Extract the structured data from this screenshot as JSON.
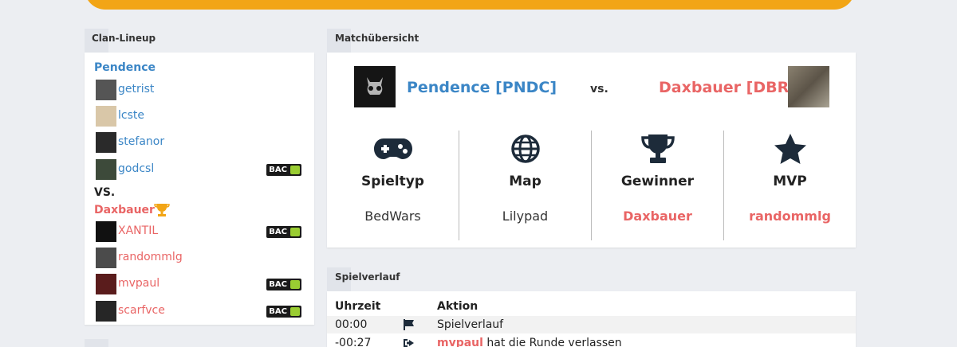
{
  "lineup": {
    "header": "Clan-Lineup",
    "team_a": {
      "name": "Pendence",
      "players": [
        {
          "name": "getrist",
          "bac": false
        },
        {
          "name": "lcste",
          "bac": false
        },
        {
          "name": "stefanor",
          "bac": false
        },
        {
          "name": "godcsl",
          "bac": true
        }
      ]
    },
    "vs": "VS.",
    "team_b": {
      "name": "Daxbauer",
      "players": [
        {
          "name": "XANTIL",
          "bac": true
        },
        {
          "name": "randommlg",
          "bac": false
        },
        {
          "name": "mvpaul",
          "bac": true
        },
        {
          "name": "scarfvce",
          "bac": true
        }
      ]
    },
    "bac_label": "BAC"
  },
  "overview": {
    "header": "Matchübersicht",
    "team_a": "Pendence [PNDC]",
    "vs": "vs.",
    "team_b": "Daxbauer [DBR]",
    "stats": [
      {
        "title": "Spieltyp",
        "value": "BedWars",
        "icon": "gamepad-icon"
      },
      {
        "title": "Map",
        "value": "Lilypad",
        "icon": "globe-icon"
      },
      {
        "title": "Gewinner",
        "value": "Daxbauer",
        "icon": "trophy-icon"
      },
      {
        "title": "MVP",
        "value": "randommlg",
        "icon": "star-icon"
      }
    ]
  },
  "log": {
    "header": "Spielverlauf",
    "col_time": "Uhrzeit",
    "col_action": "Aktion",
    "rows": [
      {
        "time": "00:00",
        "icon": "flag-icon",
        "player": "",
        "text": "Spielverlauf"
      },
      {
        "time": "-00:27",
        "icon": "leave-icon",
        "player": "mvpaul",
        "text": " hat die Runde verlassen"
      }
    ]
  },
  "colors": {
    "accent": "#f2a516",
    "team_a": "#3b86c6",
    "team_b": "#e96565"
  }
}
